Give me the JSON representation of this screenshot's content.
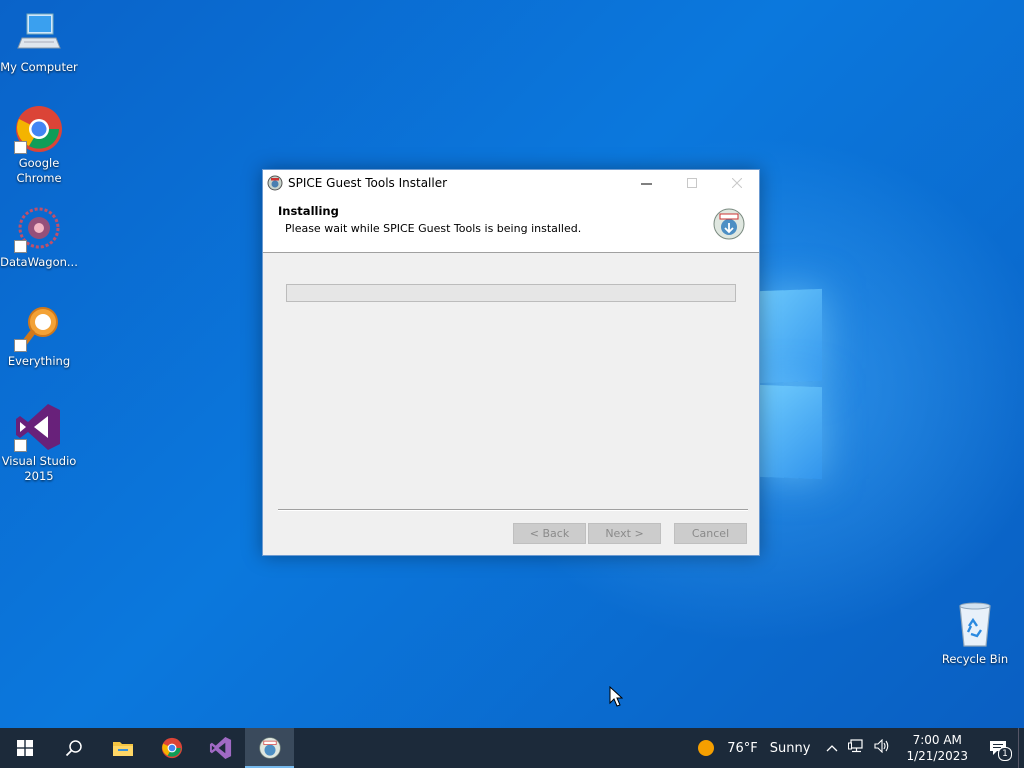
{
  "desktop": {
    "icons": [
      {
        "label": "My Computer"
      },
      {
        "label": "Google Chrome"
      },
      {
        "label": "DataWagon..."
      },
      {
        "label": "Everything"
      },
      {
        "label": "Visual Studio 2015"
      },
      {
        "label": "Recycle Bin"
      }
    ]
  },
  "window": {
    "title": "SPICE Guest Tools Installer",
    "header_title": "Installing",
    "header_subtitle": "Please wait while SPICE Guest Tools is being installed.",
    "progress": 0,
    "buttons": {
      "back": "< Back",
      "next": "Next >",
      "cancel": "Cancel"
    }
  },
  "taskbar": {
    "weather": {
      "temp": "76°F",
      "condition": "Sunny"
    },
    "time": "7:00 AM",
    "date": "1/21/2023",
    "notification_count": "1"
  },
  "colors": {
    "accent": "#0078d7",
    "progress": "#06b025"
  }
}
